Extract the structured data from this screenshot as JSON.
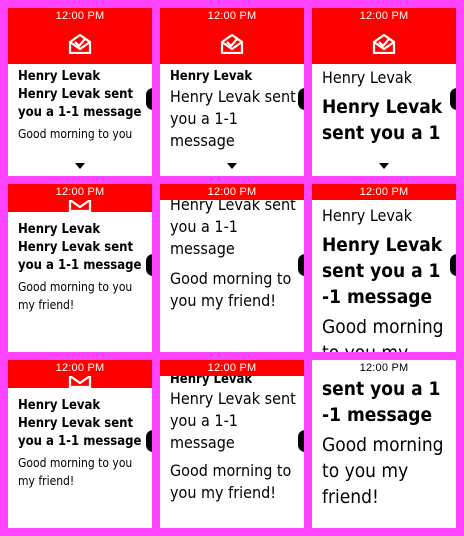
{
  "status_time": "12:00 PM",
  "notification": {
    "title": "Henry Levak",
    "subtitle": "Henry Levak sent you a 1-1 message",
    "body": "Good morning to you my friend!"
  },
  "variant_text": {
    "subtitle_short": "Henry Levak sent you a 1",
    "subtitle_tail": "-1 message",
    "subtitle_partial": "sent you a 1-1",
    "subtitle_partial_large": "sent you a 1",
    "body_partial": "Good morning to you"
  },
  "colors": {
    "frame_background": "#ff44ff",
    "status_bar": "#ff0000",
    "screen": "#ffffff",
    "text": "#000000"
  },
  "icons": {
    "banner": "open-envelope-icon",
    "more": "chevron-down-icon",
    "side": "side-action-indicator"
  }
}
